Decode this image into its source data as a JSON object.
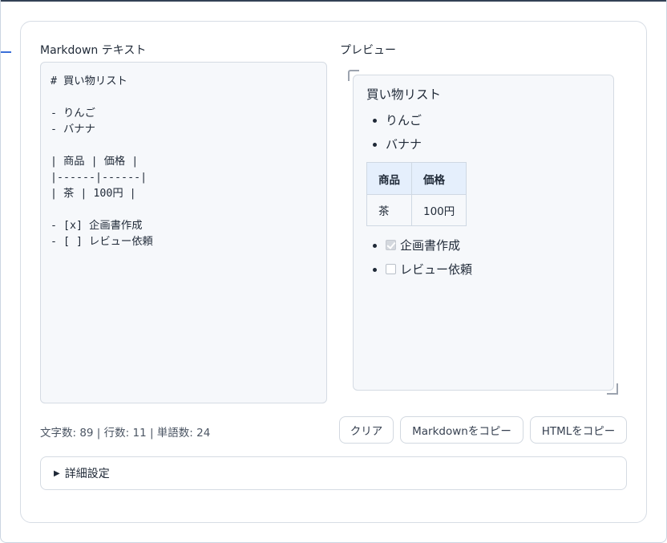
{
  "editor": {
    "label": "Markdown テキスト",
    "content": "# 買い物リスト\n\n- りんご\n- バナナ\n\n| 商品 | 価格 |\n|------|------|\n| 茶 | 100円 |\n\n- [x] 企画書作成\n- [ ] レビュー依頼"
  },
  "preview": {
    "label": "プレビュー",
    "heading": "買い物リスト",
    "list_items": [
      "りんご",
      "バナナ"
    ],
    "table": {
      "headers": [
        "商品",
        "価格"
      ],
      "rows": [
        [
          "茶",
          "100円"
        ]
      ]
    },
    "tasks": [
      {
        "label": "企画書作成",
        "checked": true
      },
      {
        "label": "レビュー依頼",
        "checked": false
      }
    ]
  },
  "stats": "文字数: 89 | 行数: 11 | 単語数: 24",
  "buttons": {
    "clear": "クリア",
    "copy_markdown": "Markdownをコピー",
    "copy_html": "HTMLをコピー"
  },
  "details": {
    "marker": "▶",
    "label": "詳細設定"
  }
}
